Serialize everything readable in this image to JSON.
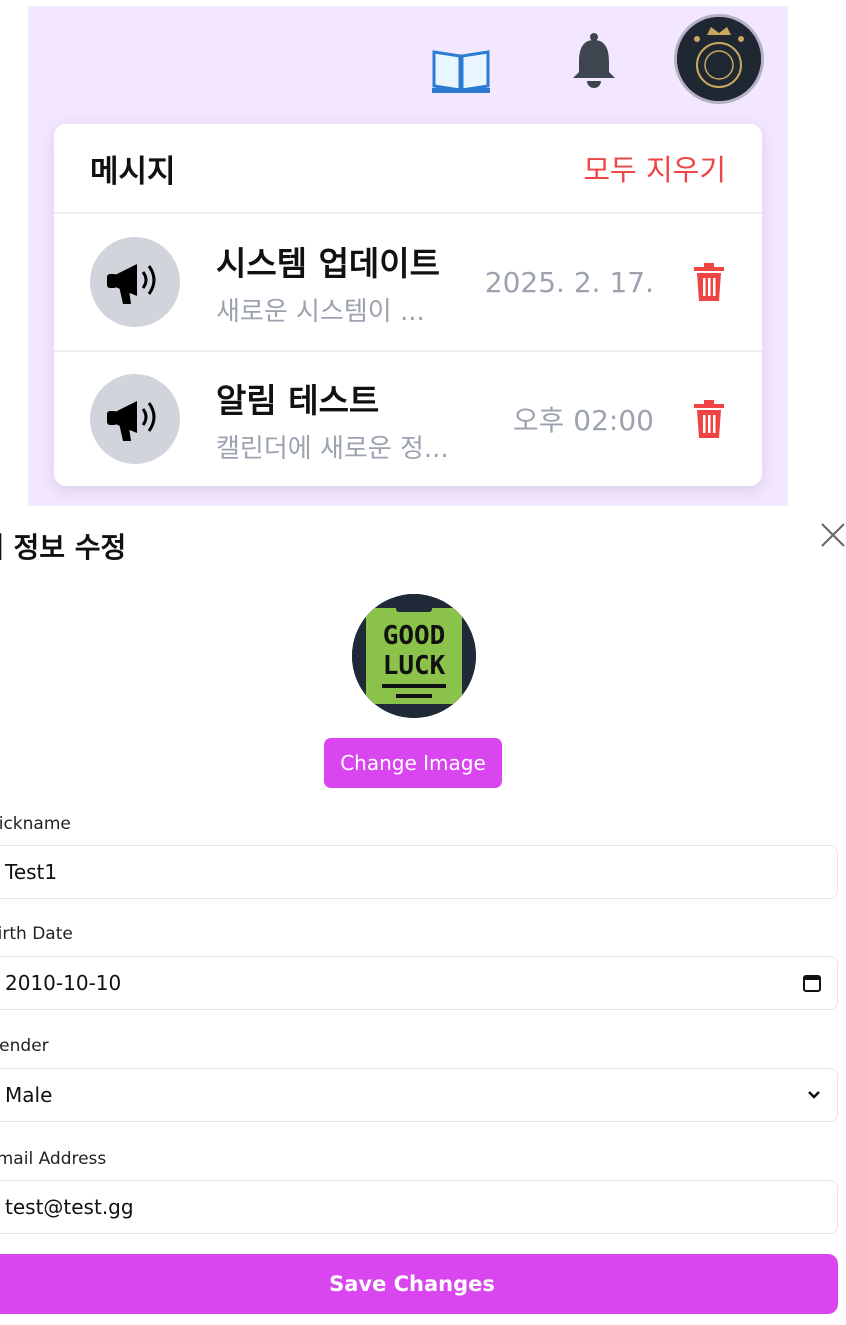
{
  "messages_panel": {
    "title": "메시지",
    "clear_all": "모두 지우기",
    "items": [
      {
        "name": "시스템 업데이트",
        "preview": "새로운 시스템이 ...",
        "time": "2025. 2. 17."
      },
      {
        "name": "알림 테스트",
        "preview": "캘린더에 새로운 정...",
        "time": "오후 02:00"
      }
    ]
  },
  "profile_avatar_text": [
    "GOOD",
    "LUCK"
  ],
  "edit_profile": {
    "title": "내 정보 수정",
    "change_image": "Change Image",
    "fields": {
      "nickname": {
        "label": "Nickname",
        "value": "Test1"
      },
      "birth_date": {
        "label": "Birth Date",
        "value": "2010-10-10"
      },
      "gender": {
        "label": "Gender",
        "value": "Male"
      },
      "email": {
        "label": "Email Address",
        "value": "test@test.gg"
      }
    },
    "save": "Save Changes"
  },
  "colors": {
    "accent": "#d946ef",
    "danger": "#ef4444",
    "panel_bg": "#f3e6ff",
    "muted_text": "#9ca3af"
  },
  "icons": [
    "book-icon",
    "bell-icon",
    "megaphone-icon",
    "trash-icon",
    "close-icon",
    "calendar-icon",
    "chevron-down-icon"
  ]
}
